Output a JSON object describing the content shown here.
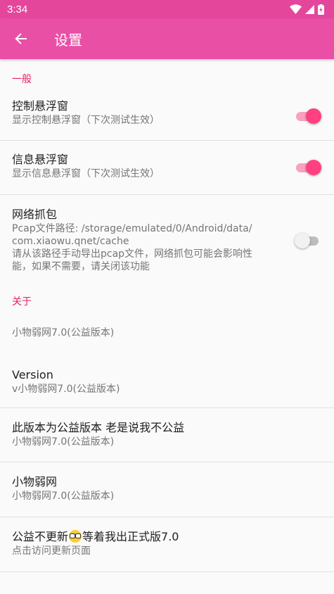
{
  "status_bar": {
    "time": "3:34"
  },
  "app_bar": {
    "title": "设置"
  },
  "sections": {
    "general": {
      "header": "一般",
      "floating_control": {
        "title": "控制悬浮窗",
        "summary": "显示控制悬浮窗（下次测试生效）",
        "enabled": true
      },
      "floating_info": {
        "title": "信息悬浮窗",
        "summary": "显示信息悬浮窗（下次测试生效）",
        "enabled": true
      },
      "packet_capture": {
        "title": "网络抓包",
        "summary_lines": [
          "Pcap文件路径: /storage/emulated/0/Android/data/",
          "com.xiaowu.qnet/cache",
          "请从该路径手动导出pcap文件，网络抓包可能会影响性",
          "能，如果不需要，请关闭该功能"
        ],
        "enabled": false
      }
    },
    "about": {
      "header": "关于",
      "app_name_line": "小物弱网7.0(公益版本)",
      "version": {
        "title": "Version",
        "summary": "v小物弱网7.0(公益版本)"
      },
      "notice": {
        "title": "此版本为公益版本 老是说我不公益",
        "summary": "小物弱网7.0(公益版本)"
      },
      "app": {
        "title": "小物弱网",
        "summary": "小物弱网7.0(公益版本)"
      },
      "update": {
        "title_before": "公益不更新",
        "title_after": "等着我出正式版7.0",
        "summary": "点击访问更新页面"
      }
    }
  },
  "colors": {
    "status_bar": "#e4469c",
    "app_bar": "#ea4fa6",
    "accent": "#e91e63",
    "switch_on": "#ff4081"
  },
  "icons": {
    "back": "arrow-back-icon",
    "wifi": "wifi-icon",
    "signal": "cell-signal-icon",
    "battery": "battery-charging-icon",
    "emoji": "nerd-face-emoji-icon"
  }
}
